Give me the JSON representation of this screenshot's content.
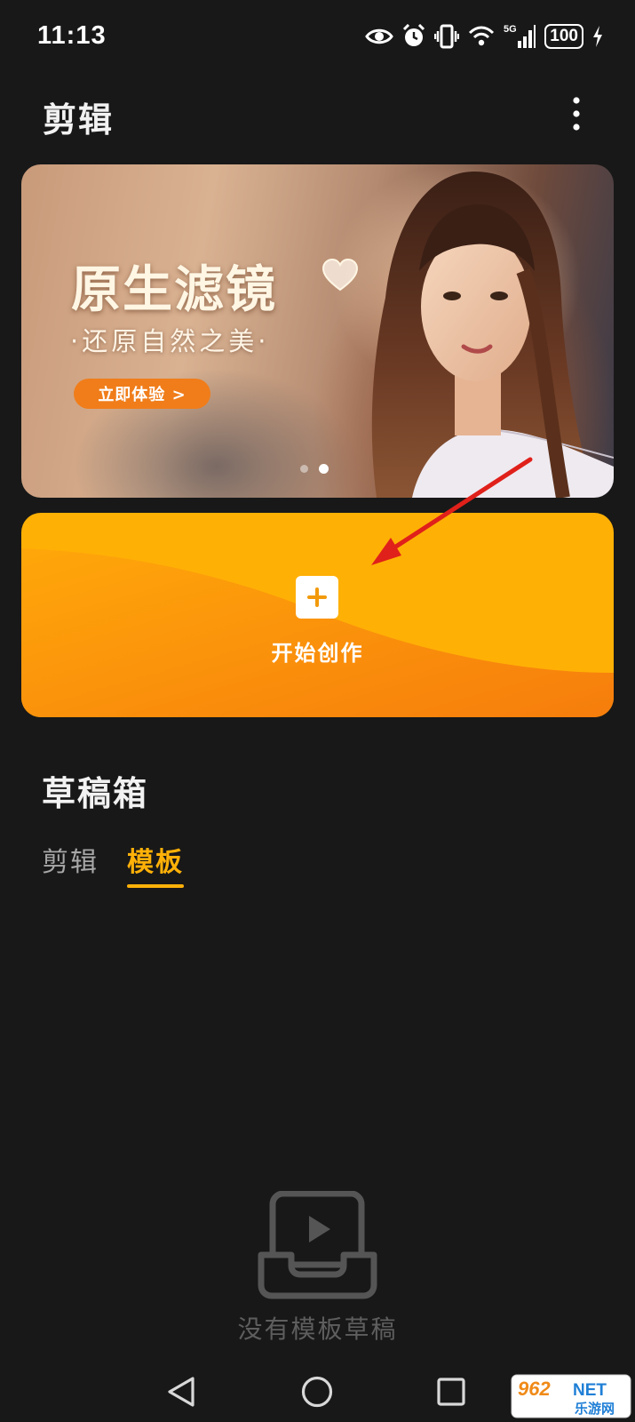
{
  "status_bar": {
    "time": "11:13",
    "network": "5G",
    "battery": "100",
    "icons": [
      "eye-icon",
      "alarm-icon",
      "vibrate-icon",
      "wifi-icon",
      "signal-icon",
      "battery-icon",
      "charging-icon"
    ]
  },
  "header": {
    "title": "剪辑",
    "more_icon": "more-vertical-icon"
  },
  "banner": {
    "heading": "原生滤镜",
    "subtitle": "·还原自然之美·",
    "cta": "立即体验 >",
    "slide_count": 2,
    "active_slide": 2
  },
  "create": {
    "label": "开始创作",
    "icon": "plus-icon"
  },
  "drafts": {
    "title": "草稿箱",
    "tabs": [
      {
        "label": "剪辑",
        "active": false
      },
      {
        "label": "模板",
        "active": true
      }
    ],
    "empty_text": "没有模板草稿",
    "empty_icon": "video-inbox-icon"
  },
  "navigation": {
    "buttons": [
      "back-icon",
      "home-icon",
      "recents-icon"
    ]
  },
  "watermark": {
    "top": "962",
    "top_suffix": "NET",
    "bottom": "乐游网"
  },
  "colors": {
    "background": "#181818",
    "accent": "#ffb108",
    "card": "#ffb005",
    "cta": "#f07d1a",
    "arrow": "#e0201a"
  }
}
